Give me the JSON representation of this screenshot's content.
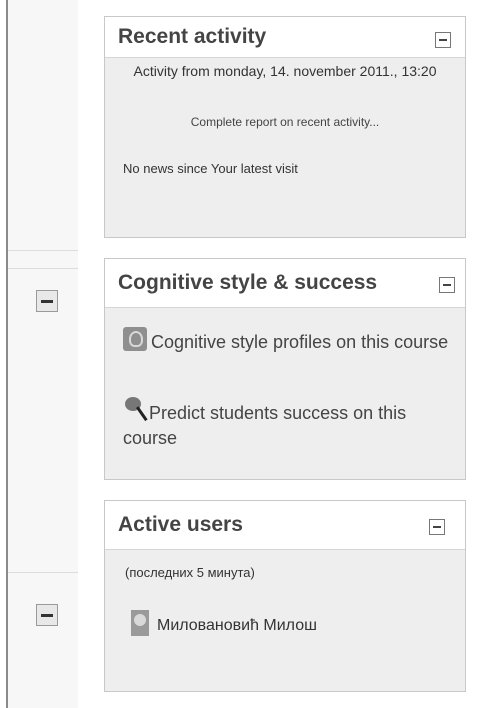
{
  "recent_activity": {
    "title": "Recent activity",
    "activity_from": "Activity from monday, 14. november 2011., 13:20",
    "full_report_link": "Complete report on recent activity...",
    "no_news": "No news since Your latest visit"
  },
  "cognitive_block": {
    "title": "Cognitive style & success",
    "items": [
      {
        "label": "Cognitive style profiles on this course",
        "icon": "brain-icon"
      },
      {
        "label": "Predict students success on this course",
        "icon": "magnifier-icon"
      }
    ]
  },
  "active_users": {
    "title": "Active users",
    "period_note": "(последних 5 минута)",
    "users": [
      {
        "name": "Миловановић Милош"
      }
    ]
  }
}
